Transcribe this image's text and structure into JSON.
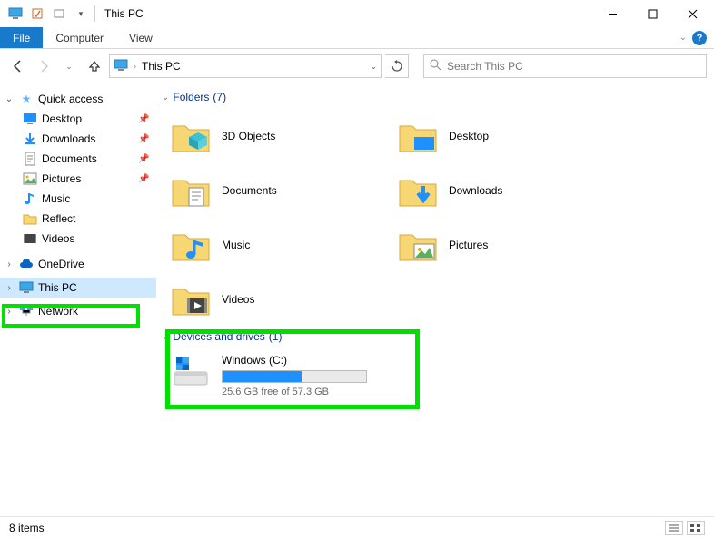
{
  "window": {
    "title": "This PC"
  },
  "ribbon": {
    "file": "File",
    "computer": "Computer",
    "view": "View"
  },
  "address": {
    "location": "This PC"
  },
  "search": {
    "placeholder": "Search This PC"
  },
  "sidebar": {
    "quick_access": "Quick access",
    "items": [
      {
        "label": "Desktop",
        "pinned": true
      },
      {
        "label": "Downloads",
        "pinned": true
      },
      {
        "label": "Documents",
        "pinned": true
      },
      {
        "label": "Pictures",
        "pinned": true
      },
      {
        "label": "Music",
        "pinned": false
      },
      {
        "label": "Reflect",
        "pinned": false
      },
      {
        "label": "Videos",
        "pinned": false
      }
    ],
    "onedrive": "OneDrive",
    "thispc": "This PC",
    "network": "Network"
  },
  "groups": {
    "folders": {
      "title": "Folders",
      "count": "(7)"
    },
    "drives": {
      "title": "Devices and drives",
      "count": "(1)"
    }
  },
  "folders": [
    {
      "label": "3D Objects"
    },
    {
      "label": "Desktop"
    },
    {
      "label": "Documents"
    },
    {
      "label": "Downloads"
    },
    {
      "label": "Music"
    },
    {
      "label": "Pictures"
    },
    {
      "label": "Videos"
    }
  ],
  "drive": {
    "label": "Windows (C:)",
    "free_text": "25.6 GB free of 57.3 GB",
    "fill_pct": 55
  },
  "status": {
    "items": "8 items"
  }
}
